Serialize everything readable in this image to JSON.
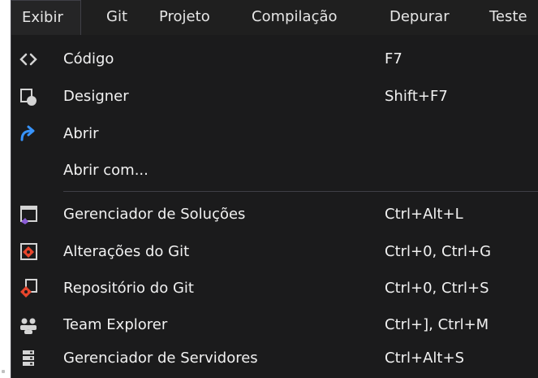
{
  "menubar": {
    "items": [
      {
        "label": "Exibir",
        "active": true
      },
      {
        "label": "Git"
      },
      {
        "label": "Projeto"
      },
      {
        "label": "Compilação"
      },
      {
        "label": "Depurar"
      },
      {
        "label": "Teste"
      }
    ]
  },
  "dropdown": {
    "items": [
      {
        "label": "Código",
        "shortcut": "F7",
        "icon": "code-icon"
      },
      {
        "label": "Designer",
        "shortcut": "Shift+F7",
        "icon": "designer-icon"
      },
      {
        "label": "Abrir",
        "shortcut": "",
        "icon": "open-arrow-icon"
      },
      {
        "label": "Abrir com...",
        "shortcut": "",
        "icon": ""
      },
      {
        "label": "Gerenciador de Soluções",
        "shortcut": "Ctrl+Alt+L",
        "icon": "solution-explorer-icon"
      },
      {
        "label": "Alterações do Git",
        "shortcut": "Ctrl+0, Ctrl+G",
        "icon": "git-changes-icon"
      },
      {
        "label": "Repositório do Git",
        "shortcut": "Ctrl+0, Ctrl+S",
        "icon": "git-repository-icon"
      },
      {
        "label": "Team Explorer",
        "shortcut": "Ctrl+], Ctrl+M",
        "icon": "team-explorer-icon"
      },
      {
        "label": "Gerenciador de Servidores",
        "shortcut": "Ctrl+Alt+S",
        "icon": "server-explorer-icon"
      }
    ]
  },
  "colors": {
    "background": "#1b1b1c",
    "text": "#f1f1f1",
    "accent_blue": "#3794ff",
    "git_red": "#e8452c",
    "vs_purple": "#8a5bd6"
  }
}
